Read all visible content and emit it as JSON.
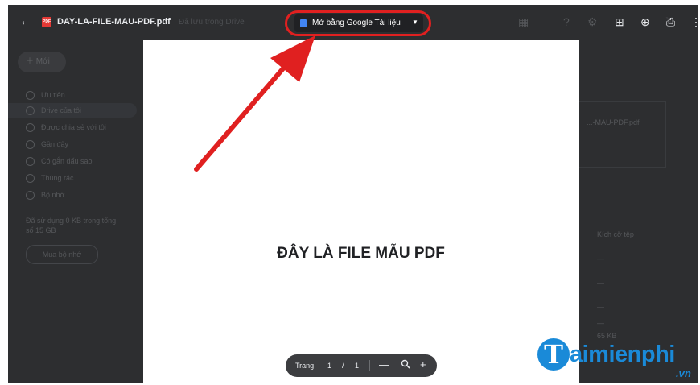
{
  "viewer": {
    "file_name": "DAY-LA-FILE-MAU-PDF.pdf",
    "faded_label": "Đã lưu trong Drive",
    "open_with_label": "Mở bằng Google Tài liệu",
    "icons": [
      "back-arrow-icon",
      "pdf-file-icon",
      "google-docs-icon",
      "dropdown-caret-icon",
      "grid-icon",
      "help-icon",
      "settings-icon",
      "add-to-drive-icon",
      "comment-icon",
      "print-icon",
      "more-options-icon"
    ]
  },
  "background_drive": {
    "new_button": "Mới",
    "nav": [
      "Ưu tiên",
      "Drive của tôi",
      "Được chia sẻ với tôi",
      "Gần đây",
      "Có gắn dấu sao",
      "Thùng rác",
      "Bộ nhớ"
    ],
    "storage_text": "Đã sử dụng 0 KB trong tổng số 15 GB",
    "storage_button": "Mua bộ nhớ",
    "right_card_text": "...-MAU-PDF.pdf",
    "right_column_header": "Kích cỡ tệp",
    "right_values": [
      "—",
      "—",
      "—",
      "—",
      "65 KB"
    ]
  },
  "document": {
    "heading": "ĐÂY LÀ FILE MẪU PDF"
  },
  "page_controls": {
    "page_label": "Trang",
    "current_page": "1",
    "separator": "/",
    "total_pages": "1",
    "zoom_out": "—",
    "zoom_in": "+"
  },
  "watermark": {
    "brand_initial": "T",
    "brand_rest": "aimienphi",
    "brand_suffix": ".vn"
  },
  "colors": {
    "highlight": "#e02020",
    "brand": "#1a8ad8"
  }
}
